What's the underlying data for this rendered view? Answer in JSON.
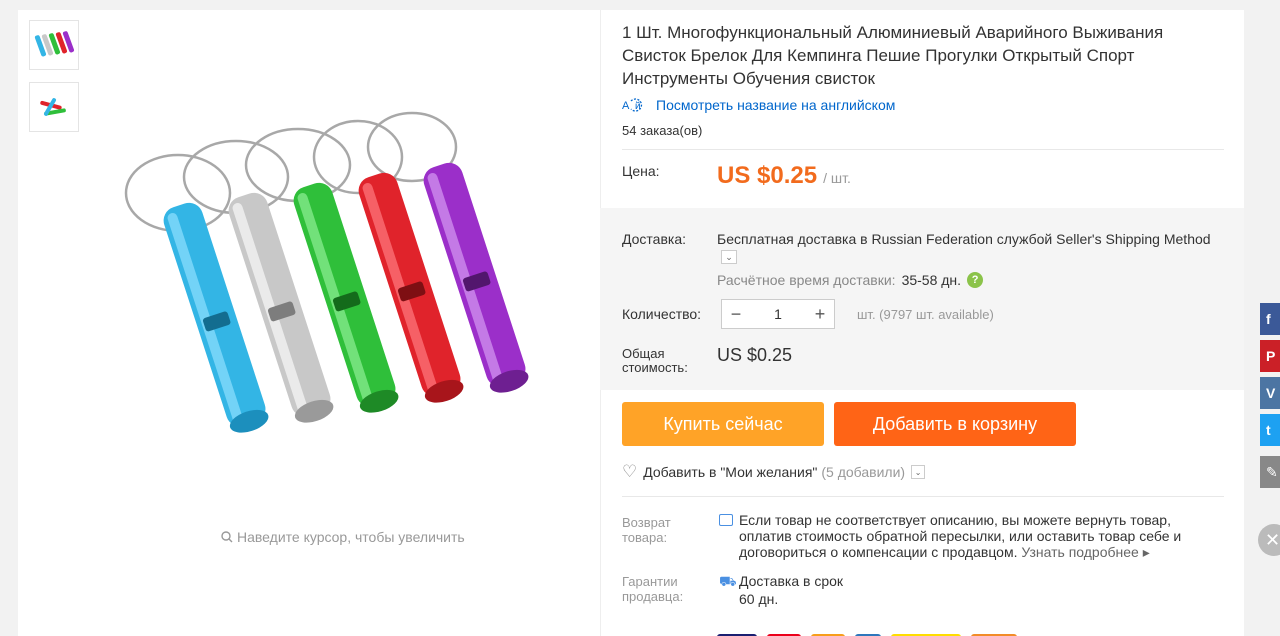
{
  "product": {
    "title": "1 Шт. Многофункциональный Алюминиевый Аварийного Выживания Свисток Брелок Для Кемпинга Пешие Прогулки Открытый Спорт Инструменты Обучения свисток",
    "translate_link": "Посмотреть название на английском",
    "orders": "54 заказа(ов)",
    "zoom_hint": "Наведите курсор, чтобы увеличить"
  },
  "price": {
    "label": "Цена:",
    "amount": "US $0.25",
    "unit": "/ шт."
  },
  "shipping": {
    "label": "Доставка:",
    "text": "Бесплатная доставка в Russian Federation службой Seller's Shipping Method",
    "eta_label": "Расчётное время доставки:",
    "eta_value": "35-58 дн."
  },
  "quantity": {
    "label": "Количество:",
    "value": "1",
    "available": "шт. (9797 шт. available)"
  },
  "total": {
    "label": "Общая стоимость:",
    "value": "US $0.25"
  },
  "actions": {
    "buy_now": "Купить сейчас",
    "add_to_cart": "Добавить в корзину",
    "wishlist": "Добавить в \"Мои желания\"",
    "wishlist_count": "(5 добавили)"
  },
  "returns": {
    "label": "Возврат товара:",
    "text": "Если товар не соответствует описанию, вы можете вернуть товар, оплатив стоимость обратной пересылки, или оставить товар себе и договориться о компенсации с продавцом.",
    "more": "Узнать подробнее"
  },
  "guarantee": {
    "label": "Гарантии продавца:",
    "text": "Доставка в срок",
    "days": "60 дн."
  },
  "colors": {
    "price": "#f26b1d",
    "buy": "#ffa327",
    "cart": "#ff6416",
    "link": "#0066cc"
  },
  "whistles": [
    "#33b5e5",
    "#c8c8c8",
    "#2fbf3a",
    "#e0232b",
    "#9b2fc9"
  ]
}
